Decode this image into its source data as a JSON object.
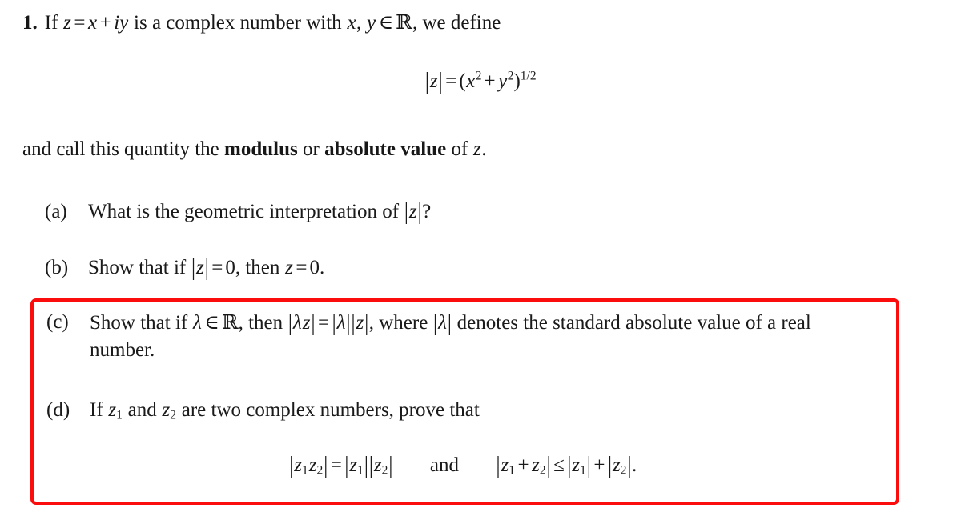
{
  "document": {
    "problem_number": "1.",
    "stem": {
      "before_z": "If",
      "z": "z",
      "equals": "=",
      "x": "x",
      "plus": "+",
      "iy": "iy",
      "middle": "is a complex number with",
      "var_x": "x",
      "comma": ",",
      "var_y": "y",
      "in": "∈",
      "reals": "ℝ",
      "after": ", we define"
    },
    "equation_1": {
      "lhs_bar": "|",
      "lhs_var": "z",
      "equals": "=",
      "open_paren": "(",
      "x": "x",
      "x_exp": "2",
      "plus": "+",
      "y": "y",
      "y_exp": "2",
      "close_paren": ")",
      "outer_exp": "1/2",
      "plain": "|z| = (x² + y²)^(1/2)"
    },
    "call_line": {
      "part1": "and call this quantity the",
      "bold1": "modulus",
      "part2": "or",
      "bold2": "absolute value",
      "part3": "of",
      "var_z": "z",
      "period": "."
    },
    "items": [
      {
        "label": "(a)",
        "text_1": "What is the geometric interpretation of",
        "math_1": "|z|",
        "text_2": "?",
        "highlighted": false,
        "plain": "What is the geometric interpretation of |z|?"
      },
      {
        "label": "(b)",
        "text_1": "Show that if",
        "math_1": "|z| = 0",
        "text_2": ", then",
        "math_2": "z = 0",
        "text_3": ".",
        "highlighted": false,
        "plain": "Show that if |z| = 0, then z = 0."
      },
      {
        "label": "(c)",
        "text_1": "Show that if",
        "math_1": "λ ∈ ℝ",
        "text_2": ", then",
        "math_2": "|λz| = |λ||z|",
        "text_3": ", where",
        "math_3": "|λ|",
        "text_4": "denotes the standard absolute value of a real number.",
        "highlighted": true,
        "plain": "Show that if λ ∈ ℝ, then |λz| = |λ||z|, where |λ| denotes the standard absolute value of a real number."
      },
      {
        "label": "(d)",
        "text_1": "If",
        "math_1": "z₁",
        "text_2": "and",
        "math_2": "z₂",
        "text_3": "are two complex numbers, prove that",
        "highlighted": true,
        "plain": "If z₁ and z₂ are two complex numbers, prove that"
      }
    ],
    "equation_2": {
      "left": "|z₁z₂| = |z₁||z₂|",
      "conjunction": "and",
      "right": "|z₁ + z₂| ≤ |z₁| + |z₂|.",
      "less_equal": "≤"
    },
    "annotation": {
      "type": "rectangle-highlight",
      "color": "#fb0d0d",
      "border_width_px": 4,
      "covers_items": "(c) and (d)"
    }
  }
}
